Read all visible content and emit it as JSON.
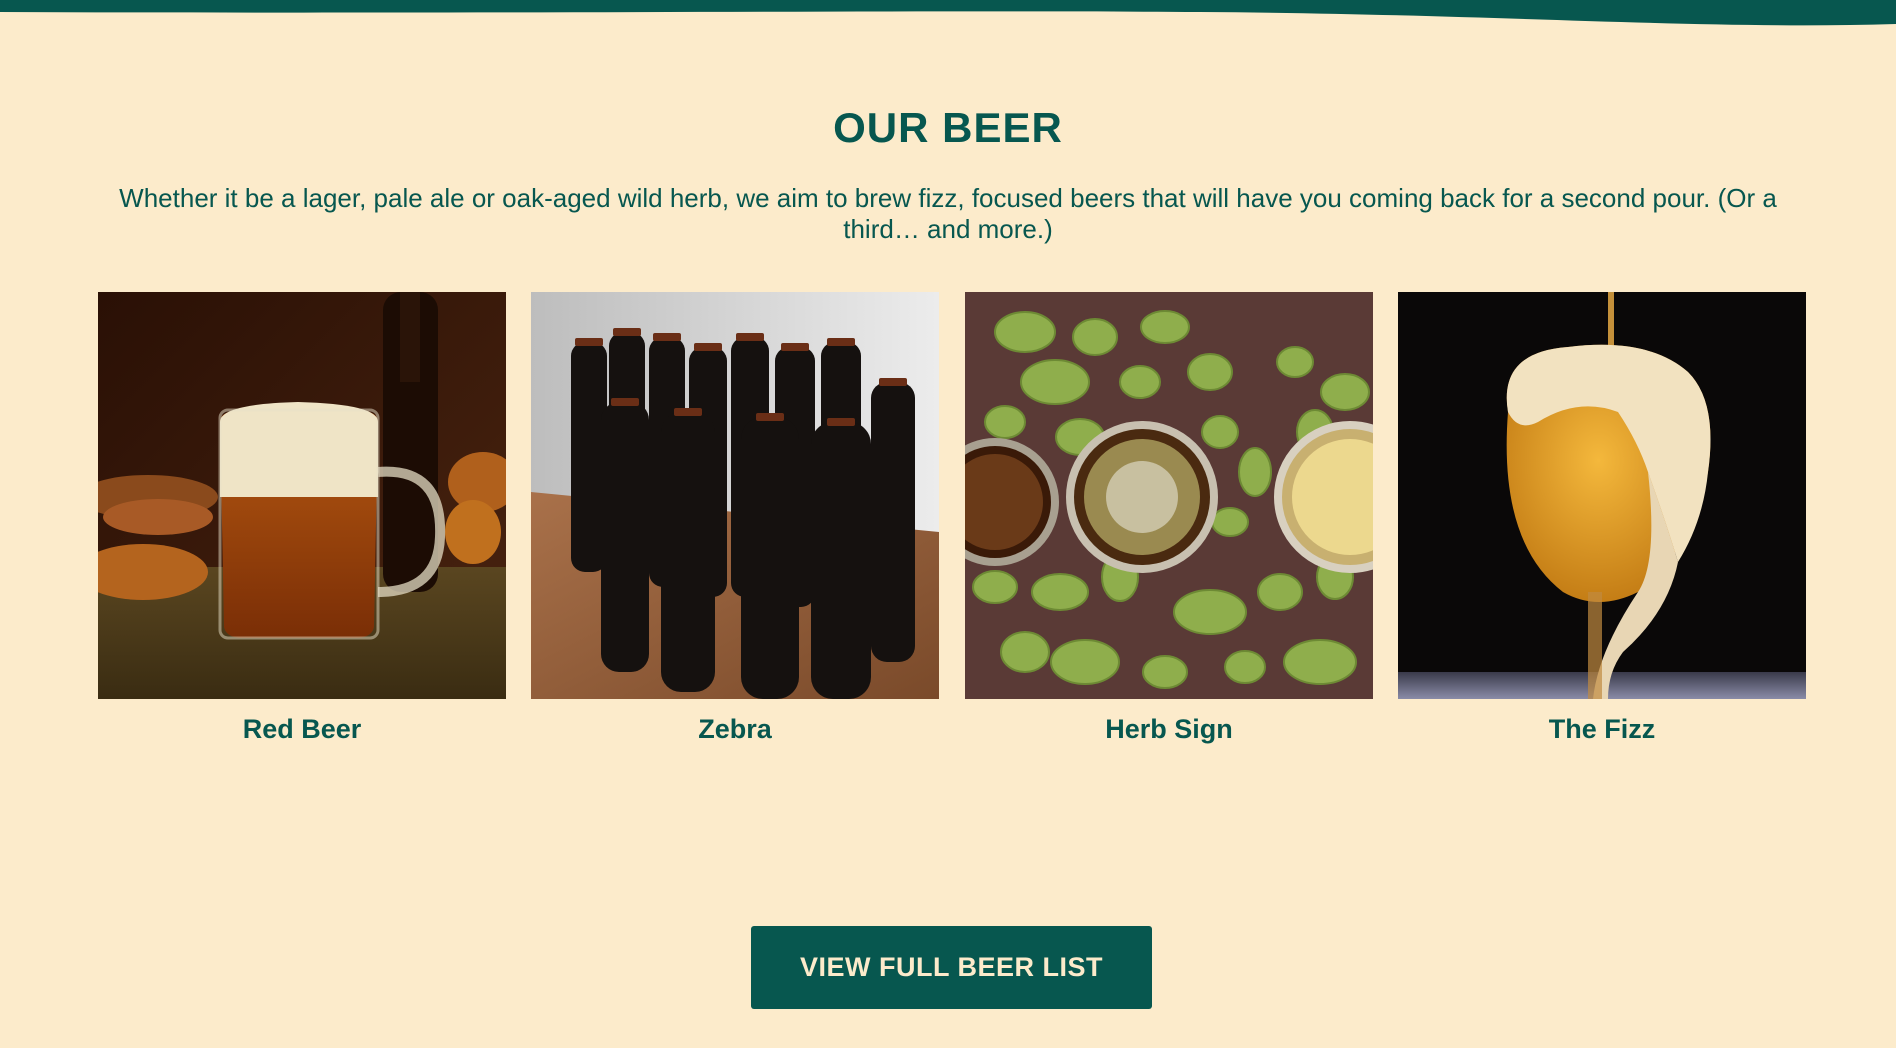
{
  "section": {
    "title": "OUR BEER",
    "intro": "Whether it be a lager, pale ale or oak-aged wild herb, we aim to brew fizz, focused beers that will have you coming back for a second pour. (Or a third… and more.)"
  },
  "beers": [
    {
      "name": "Red Beer"
    },
    {
      "name": "Zebra"
    },
    {
      "name": "Herb Sign"
    },
    {
      "name": "The Fizz"
    }
  ],
  "cta": {
    "label": "VIEW FULL BEER LIST"
  },
  "colors": {
    "background": "#fcebcb",
    "brand": "#07574f"
  }
}
